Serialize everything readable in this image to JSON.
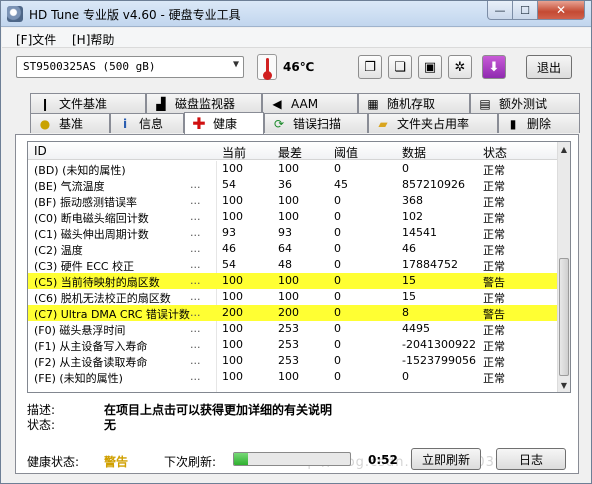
{
  "window": {
    "title": "HD Tune 专业版 v4.60 - 硬盘专业工具",
    "min_label": "—",
    "max_label": "☐",
    "close_label": "✕"
  },
  "menu": {
    "file": "[F]文件",
    "help": "[H]帮助"
  },
  "toolbar": {
    "drive": "ST9500325AS (500 gB)",
    "temperature": "46℃",
    "exit_label": "退出"
  },
  "tabs_row1": [
    {
      "label": "文件基准",
      "icon": "file-benchmark-icon"
    },
    {
      "label": "磁盘监视器",
      "icon": "disk-monitor-icon"
    },
    {
      "label": "AAM",
      "icon": "speaker-icon"
    },
    {
      "label": "随机存取",
      "icon": "random-access-icon"
    },
    {
      "label": "额外测试",
      "icon": "extra-tests-icon"
    }
  ],
  "tabs_row2": [
    {
      "label": "基准",
      "icon": "lightbulb-icon"
    },
    {
      "label": "信息",
      "icon": "info-icon"
    },
    {
      "label": "健康",
      "icon": "health-cross-icon"
    },
    {
      "label": "错误扫描",
      "icon": "error-scan-icon"
    },
    {
      "label": "文件夹占用率",
      "icon": "folder-icon"
    },
    {
      "label": "删除",
      "icon": "trash-icon"
    }
  ],
  "active_tab": "健康",
  "table": {
    "headers": {
      "id": "ID",
      "current": "当前",
      "worst": "最差",
      "threshold": "阈值",
      "data": "数据",
      "status": "状态"
    },
    "rows": [
      {
        "id": "(BD) (未知的属性)",
        "dots": "",
        "current": "100",
        "worst": "100",
        "threshold": "0",
        "data": "0",
        "status": "正常",
        "warn": false
      },
      {
        "id": "(BE) 气流温度",
        "dots": "...",
        "current": "54",
        "worst": "36",
        "threshold": "45",
        "data": "857210926",
        "status": "正常",
        "warn": false
      },
      {
        "id": "(BF) 振动感测错误率",
        "dots": "...",
        "current": "100",
        "worst": "100",
        "threshold": "0",
        "data": "368",
        "status": "正常",
        "warn": false
      },
      {
        "id": "(C0) 断电磁头缩回计数",
        "dots": "...",
        "current": "100",
        "worst": "100",
        "threshold": "0",
        "data": "102",
        "status": "正常",
        "warn": false
      },
      {
        "id": "(C1) 磁头伸出周期计数",
        "dots": "...",
        "current": "93",
        "worst": "93",
        "threshold": "0",
        "data": "14541",
        "status": "正常",
        "warn": false
      },
      {
        "id": "(C2) 温度",
        "dots": "...",
        "current": "46",
        "worst": "64",
        "threshold": "0",
        "data": "46",
        "status": "正常",
        "warn": false
      },
      {
        "id": "(C3) 硬件 ECC 校正",
        "dots": "...",
        "current": "54",
        "worst": "48",
        "threshold": "0",
        "data": "17884752",
        "status": "正常",
        "warn": false
      },
      {
        "id": "(C5) 当前待映射的扇区数",
        "dots": "...",
        "current": "100",
        "worst": "100",
        "threshold": "0",
        "data": "15",
        "status": "警告",
        "warn": true
      },
      {
        "id": "(C6) 脱机无法校正的扇区数",
        "dots": "...",
        "current": "100",
        "worst": "100",
        "threshold": "0",
        "data": "15",
        "status": "正常",
        "warn": false
      },
      {
        "id": "(C7) Ultra DMA CRC 错误计数",
        "dots": "...",
        "current": "200",
        "worst": "200",
        "threshold": "0",
        "data": "8",
        "status": "警告",
        "warn": true
      },
      {
        "id": "(F0) 磁头悬浮时间",
        "dots": "...",
        "current": "100",
        "worst": "253",
        "threshold": "0",
        "data": "4495",
        "status": "正常",
        "warn": false
      },
      {
        "id": "(F1) 从主设备写入寿命",
        "dots": "...",
        "current": "100",
        "worst": "253",
        "threshold": "0",
        "data": "-2041300922",
        "status": "正常",
        "warn": false
      },
      {
        "id": "(F2) 从主设备读取寿命",
        "dots": "...",
        "current": "100",
        "worst": "253",
        "threshold": "0",
        "data": "-1523799056",
        "status": "正常",
        "warn": false
      },
      {
        "id": "(FE) (未知的属性)",
        "dots": "...",
        "current": "100",
        "worst": "100",
        "threshold": "0",
        "data": "0",
        "status": "正常",
        "warn": false
      }
    ]
  },
  "description": {
    "desc_label": "描述:",
    "desc_value": "在项目上点击可以获得更加详细的有关说明",
    "status_label": "状态:",
    "status_value": "无"
  },
  "footer": {
    "health_label": "健康状态:",
    "health_value": "警告",
    "health_color": "#d0a000",
    "refresh_label": "下次刷新:",
    "refresh_progress": 0.12,
    "countdown": "0:52",
    "refresh_button": "立即刷新",
    "log_button": "日志",
    "watermark": "http://blog.csdn.net/u010039659"
  },
  "colors": {
    "warning_row": "#ffff33",
    "accent": "#2fb02f"
  }
}
